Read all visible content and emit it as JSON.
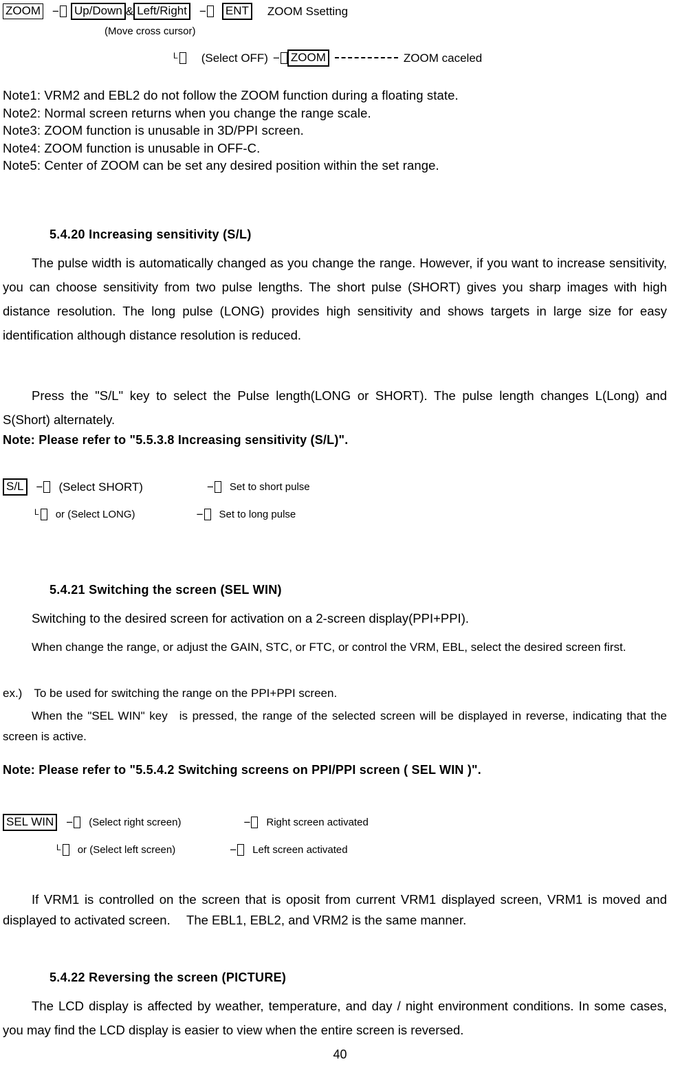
{
  "page": {
    "number": "40"
  },
  "zoom_flow": {
    "row1": {
      "key1": "ZOOM",
      "dash1": "−",
      "key2": "Up/Down",
      "amp": "&",
      "key3": "Left/Right",
      "dash2": "−",
      "key4": "ENT",
      "result": "ZOOM Ssetting"
    },
    "row2": {
      "caption": "(Move cross cursor)"
    },
    "row3": {
      "elbow": "L",
      "select": "(Select OFF)",
      "dash": "−",
      "key": "ZOOM",
      "result": "ZOOM caceled"
    }
  },
  "notes": [
    "Note1: VRM2 and EBL2 do not follow the ZOOM function during a floating state.",
    "Note2: Normal screen returns when you change the range scale.",
    "Note3: ZOOM function is unusable in 3D/PPI screen.",
    "Note4: ZOOM function is unusable in OFF-C.",
    "Note5: Center of ZOOM can be set any desired position within the set range."
  ],
  "section_5_4_20": {
    "heading": "5.4.20 Increasing sensitivity (S/L)",
    "para1": "The pulse width is automatically changed as you change the range. However, if you want to increase sensitivity, you can choose sensitivity from two pulse lengths. The short pulse (SHORT) gives you sharp images with high distance resolution. The long pulse (LONG) provides high sensitivity and shows targets in large size for easy identification although distance resolution is reduced.",
    "para2": "Press the \"S/L\" key to select the Pulse length(LONG or SHORT). The pulse length changes L(Long) and S(Short) alternately.",
    "note": "Note: Please refer to \"5.5.3.8 Increasing sensitivity (S/L)\".",
    "flow": {
      "key": "S/L",
      "dash": "−",
      "row1_select": "(Select SHORT)",
      "row1_dash": "−",
      "row1_result": "Set to short pulse",
      "elbow": "L",
      "row2_select": "or (Select LONG)",
      "row2_dash": "−",
      "row2_result": "Set to long pulse"
    }
  },
  "section_5_4_21": {
    "heading": "5.4.21 Switching the screen (SEL WIN)",
    "para1": "Switching to the desired screen for activation on a 2-screen display(PPI+PPI).",
    "para2": "When change the range, or adjust the GAIN, STC, or FTC, or control the VRM, EBL, select the desired screen first.",
    "para3": "ex.) To be used for switching the range on the PPI+PPI screen.",
    "para4": "When the \"SEL WIN\" key is pressed, the range of the selected screen will be displayed in reverse, indicating that the screen is active.",
    "note": "Note: Please refer to \"5.5.4.2 Switching screens on PPI/PPI screen ( SEL WIN )\".",
    "flow": {
      "key": "SEL WIN",
      "dash": "−",
      "row1_select": "(Select right screen)",
      "row1_dash": "−",
      "row1_result": "Right screen activated",
      "elbow": "L",
      "row2_select": "or (Select left screen)",
      "row2_dash": "−",
      "row2_result": "Left screen activated"
    },
    "para5": "If VRM1 is controlled on the screen that is oposit from current VRM1 displayed screen, VRM1 is moved and displayed to activated screen.  The EBL1, EBL2, and VRM2 is the same manner."
  },
  "section_5_4_22": {
    "heading": "5.4.22 Reversing the screen (PICTURE)",
    "para1": "The LCD display is affected by weather, temperature, and day / night environment conditions. In some cases, you may find the LCD display is easier to view when the entire screen is reversed."
  }
}
